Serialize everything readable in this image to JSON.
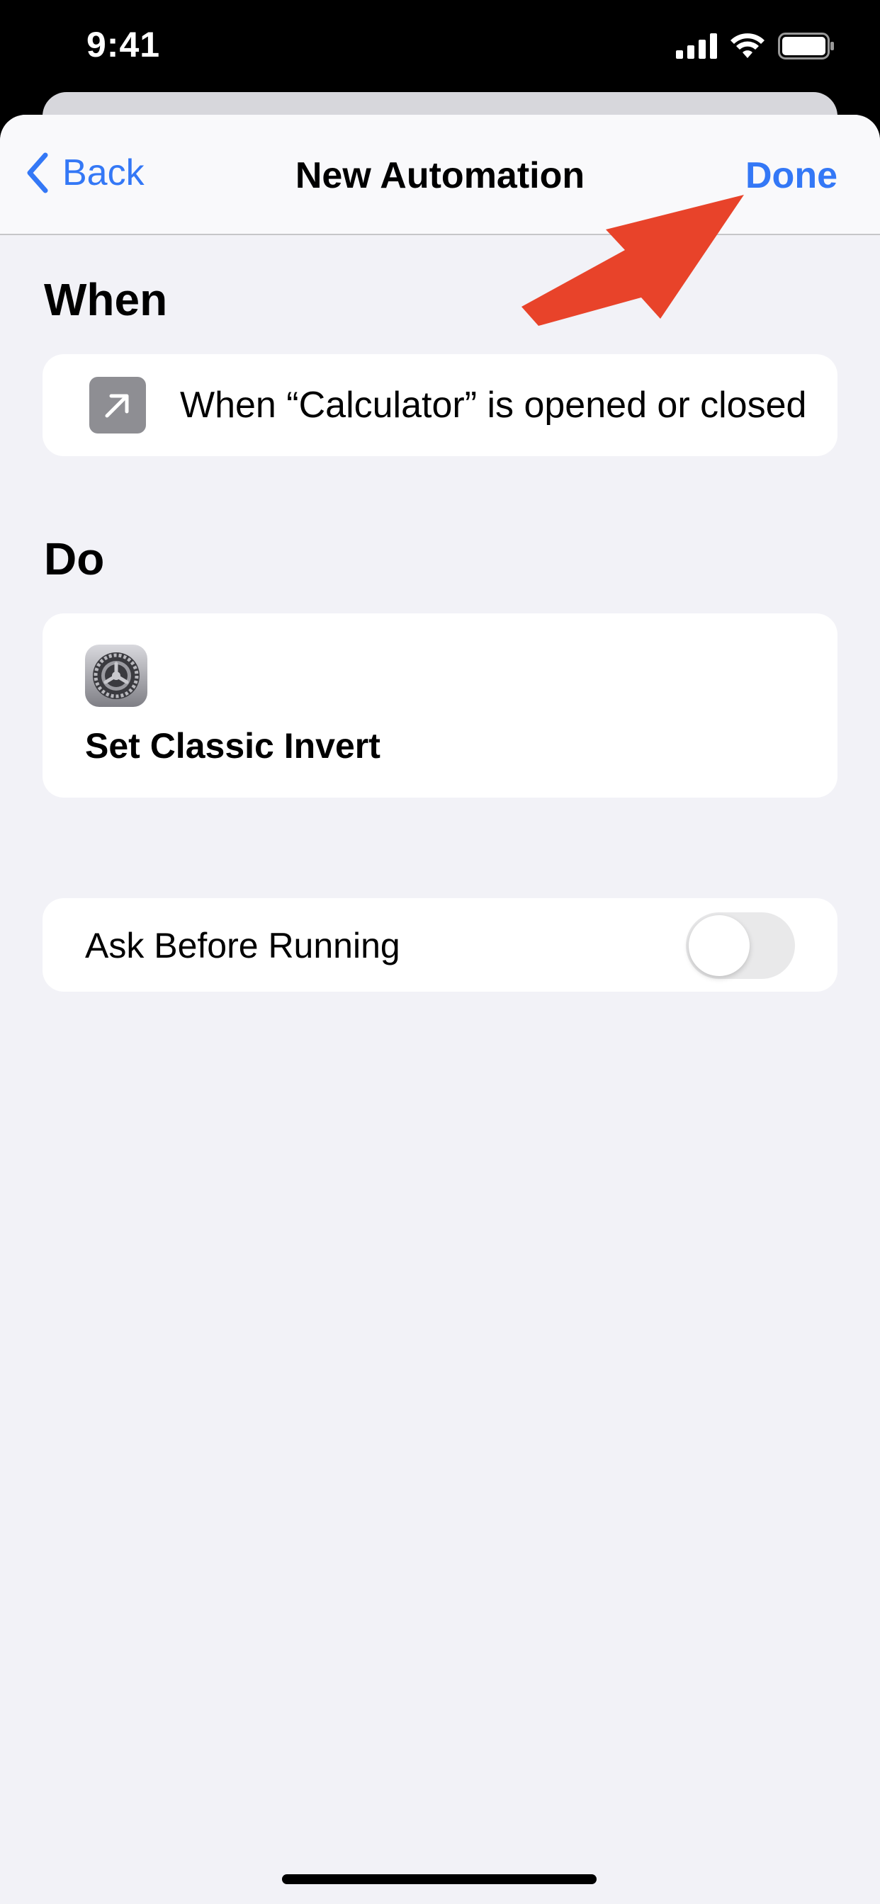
{
  "status_bar": {
    "time": "9:41"
  },
  "nav": {
    "back_label": "Back",
    "title": "New Automation",
    "done_label": "Done"
  },
  "when": {
    "heading": "When",
    "trigger_text": "When “Calculator” is opened or closed",
    "icon": "arrow-up-right-icon"
  },
  "do": {
    "heading": "Do",
    "action_label": "Set Classic Invert",
    "icon": "settings-gear-icon"
  },
  "ask_before_running": {
    "label": "Ask Before Running",
    "enabled": false
  },
  "colors": {
    "accent": "#3478f6",
    "annotation_arrow": "#e8432a",
    "background": "#f2f2f7"
  }
}
